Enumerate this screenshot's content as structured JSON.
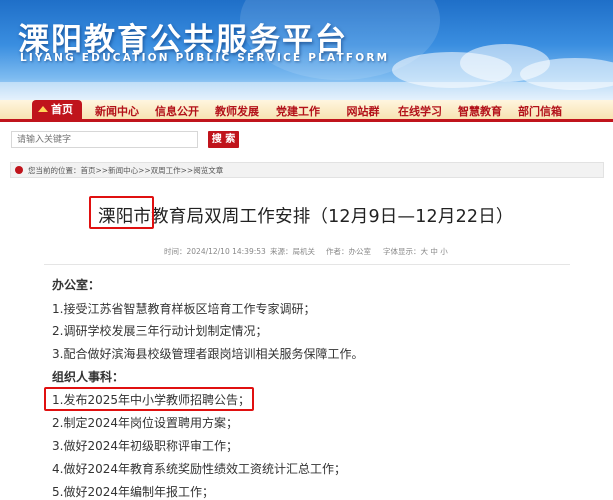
{
  "header": {
    "title": "溧阳教育公共服务平台",
    "subtitle": "LIYANG EDUCATION PUBLIC SERVICE PLATFORM"
  },
  "nav": {
    "items": [
      {
        "label": "首页"
      },
      {
        "label": "新闻中心"
      },
      {
        "label": "信息公开"
      },
      {
        "label": "教师发展"
      },
      {
        "label": "党建工作"
      },
      {
        "label": "网站群"
      },
      {
        "label": "在线学习"
      },
      {
        "label": "智慧教育"
      },
      {
        "label": "部门信箱"
      }
    ]
  },
  "search": {
    "placeholder": "请输入关键字",
    "button_label": "搜 索"
  },
  "breadcrumb": {
    "text": "您当前的位置：首页>>新闻中心>>双周工作>>阅览文章"
  },
  "article": {
    "title": "溧阳市教育局双周工作安排（12月9日—12月22日）",
    "time": "时间：2024/12/10 14:39:53",
    "source": "来源：局机关",
    "author": "作者：办公室",
    "font_size": "字体显示：大 中 小",
    "sections": [
      {
        "heading": "办公室：",
        "items": [
          "1.接受江苏省智慧教育样板区培育工作专家调研；",
          "2.调研学校发展三年行动计划制定情况；",
          "3.配合做好滨海县校级管理者跟岗培训相关服务保障工作。"
        ]
      },
      {
        "heading": "组织人事科：",
        "items": [
          "1.发布2025年中小学教师招聘公告；",
          "2.制定2024年岗位设置聘用方案；",
          "3.做好2024年初级职称评审工作；",
          "4.做好2024年教育系统奖励性绩效工资统计汇总工作；",
          "5.做好2024年编制年报工作；"
        ]
      }
    ]
  },
  "colors": {
    "brand_red": "#c0141c",
    "banner_blue": "#1f6fc8",
    "annotation_red": "#e01010"
  }
}
